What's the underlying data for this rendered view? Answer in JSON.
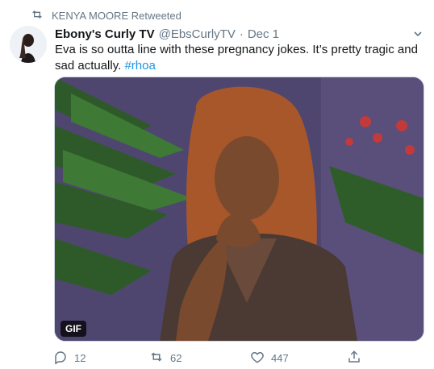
{
  "retweet": {
    "label": "KENYA MOORE Retweeted",
    "icon": "retweet-icon"
  },
  "author": {
    "name": "Ebony's Curly TV",
    "handle": "@EbsCurlyTV",
    "separator": "·",
    "time": "Dec 1"
  },
  "tweet": {
    "text_main": "Eva is so outta line with these pregnancy jokes. It’s pretty tragic and sad actually. ",
    "hashtag": "#rhoa"
  },
  "media": {
    "badge": "GIF"
  },
  "actions": {
    "reply_count": "12",
    "retweet_count": "62",
    "like_count": "447"
  },
  "colors": {
    "accent": "#1b95e0",
    "muted": "#657786",
    "text": "#14171a"
  }
}
